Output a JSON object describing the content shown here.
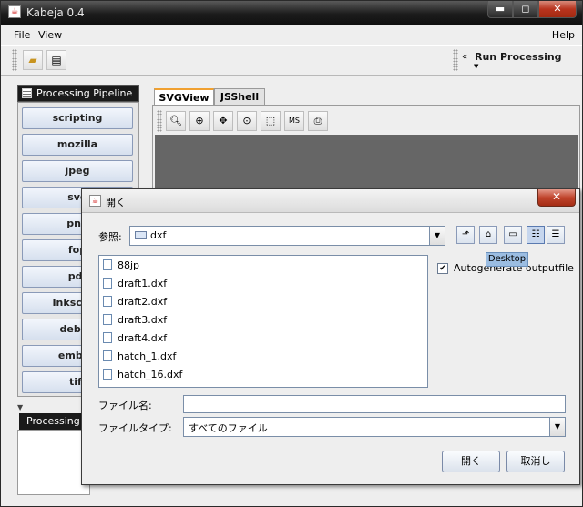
{
  "window": {
    "title": "Kabeja 0.4"
  },
  "menu": {
    "file": "File",
    "view": "View",
    "help": "Help"
  },
  "toolbar": {
    "run_label": "Run Processing"
  },
  "pipeline": {
    "tab_label": "Processing Pipeline",
    "items": [
      "scripting",
      "mozilla",
      "jpeg",
      "svg",
      "png",
      "fop",
      "pdf",
      "Inkscape",
      "debug",
      "embed",
      "tiff"
    ]
  },
  "log": {
    "tab_label": "Processing"
  },
  "view_tabs": [
    "SVGView",
    "JSShell"
  ],
  "view_tools": {
    "ms_label": "MS"
  },
  "dialog": {
    "title": "開く",
    "look_in_label": "参照:",
    "look_in_value": "dxf",
    "tooltip": "Desktop",
    "files": [
      "88jp",
      "draft1.dxf",
      "draft2.dxf",
      "draft3.dxf",
      "draft4.dxf",
      "hatch_1.dxf",
      "hatch_16.dxf"
    ],
    "autogenerate_label": "Autogenerate outputfile",
    "autogenerate_checked": true,
    "filename_label": "ファイル名:",
    "filename_value": "",
    "filetype_label": "ファイルタイプ:",
    "filetype_value": "すべてのファイル",
    "open_button": "開く",
    "cancel_button": "取消し"
  }
}
